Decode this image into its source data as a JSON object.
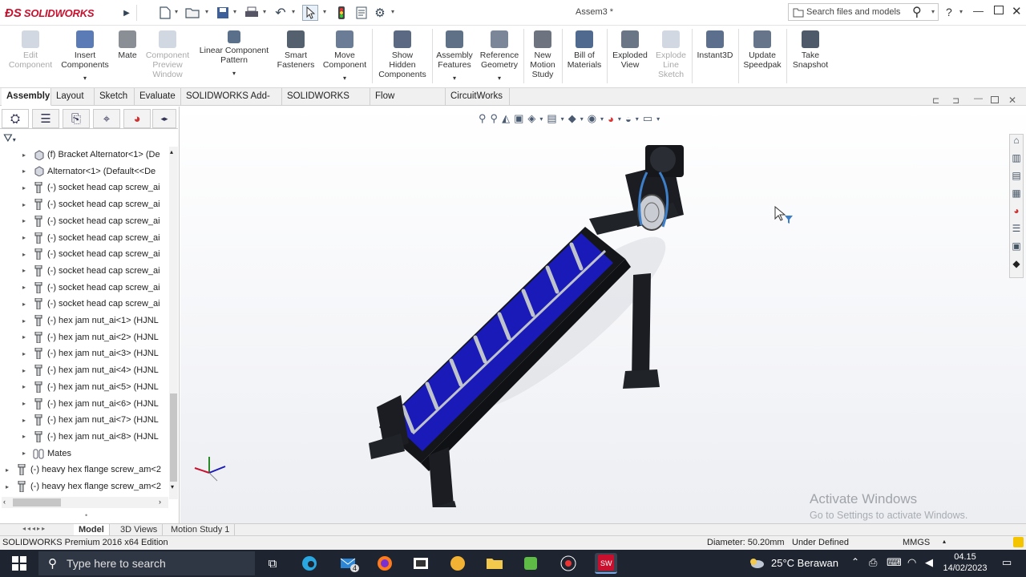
{
  "app": {
    "brand": "SOLIDWORKS",
    "doc_title": "Assem3 *"
  },
  "search": {
    "placeholder": "Search files and models"
  },
  "commands": [
    {
      "label": "Edit Component",
      "lines": [
        "Edit",
        "Component"
      ],
      "enabled": false,
      "icon": "edit-component-icon"
    },
    {
      "label": "Insert Components",
      "lines": [
        "Insert",
        "Components"
      ],
      "enabled": true,
      "icon": "insert-components-icon"
    },
    {
      "label": "Mate",
      "lines": [
        "Mate"
      ],
      "enabled": true,
      "icon": "mate-icon"
    },
    {
      "label": "Component Preview Window",
      "lines": [
        "Component",
        "Preview",
        "Window"
      ],
      "enabled": false,
      "icon": "preview-window-icon"
    },
    {
      "label": "Linear Component Pattern",
      "lines": [
        "Linear Component",
        "Pattern"
      ],
      "enabled": true,
      "icon": "linear-pattern-icon"
    },
    {
      "label": "Smart Fasteners",
      "lines": [
        "Smart",
        "Fasteners"
      ],
      "enabled": true,
      "icon": "smart-fasteners-icon"
    },
    {
      "label": "Move Component",
      "lines": [
        "Move",
        "Component"
      ],
      "enabled": true,
      "icon": "move-component-icon"
    },
    {
      "label": "Show Hidden Components",
      "lines": [
        "Show",
        "Hidden",
        "Components"
      ],
      "enabled": true,
      "icon": "show-hidden-icon"
    },
    {
      "label": "Assembly Features",
      "lines": [
        "Assembly",
        "Features"
      ],
      "enabled": true,
      "icon": "assembly-features-icon"
    },
    {
      "label": "Reference Geometry",
      "lines": [
        "Reference",
        "Geometry"
      ],
      "enabled": true,
      "icon": "reference-geometry-icon"
    },
    {
      "label": "New Motion Study",
      "lines": [
        "New",
        "Motion",
        "Study"
      ],
      "enabled": true,
      "icon": "motion-study-icon"
    },
    {
      "label": "Bill of Materials",
      "lines": [
        "Bill of",
        "Materials"
      ],
      "enabled": true,
      "icon": "bom-icon"
    },
    {
      "label": "Exploded View",
      "lines": [
        "Exploded",
        "View"
      ],
      "enabled": true,
      "icon": "exploded-view-icon"
    },
    {
      "label": "Explode Line Sketch",
      "lines": [
        "Explode",
        "Line",
        "Sketch"
      ],
      "enabled": false,
      "icon": "explode-line-icon"
    },
    {
      "label": "Instant3D",
      "lines": [
        "Instant3D"
      ],
      "enabled": true,
      "icon": "instant3d-icon"
    },
    {
      "label": "Update Speedpak",
      "lines": [
        "Update",
        "Speedpak"
      ],
      "enabled": true,
      "icon": "speedpak-icon"
    },
    {
      "label": "Take Snapshot",
      "lines": [
        "Take",
        "Snapshot"
      ],
      "enabled": true,
      "icon": "snapshot-icon"
    }
  ],
  "tabs": [
    "Assembly",
    "Layout",
    "Sketch",
    "Evaluate",
    "SOLIDWORKS Add-Ins",
    "SOLIDWORKS MBD",
    "Flow Simulation",
    "CircuitWorks"
  ],
  "active_tab": "Assembly",
  "tree": [
    {
      "text": "(f) Bracket Alternator<1> (De",
      "indent": 1,
      "icon": "part-icon"
    },
    {
      "text": "Alternator<1> (Default<<De",
      "indent": 1,
      "icon": "part-icon"
    },
    {
      "text": "(-) socket head cap screw_ai",
      "indent": 1,
      "icon": "screw-icon"
    },
    {
      "text": "(-) socket head cap screw_ai",
      "indent": 1,
      "icon": "screw-icon"
    },
    {
      "text": "(-) socket head cap screw_ai",
      "indent": 1,
      "icon": "screw-icon"
    },
    {
      "text": "(-) socket head cap screw_ai",
      "indent": 1,
      "icon": "screw-icon"
    },
    {
      "text": "(-) socket head cap screw_ai",
      "indent": 1,
      "icon": "screw-icon"
    },
    {
      "text": "(-) socket head cap screw_ai",
      "indent": 1,
      "icon": "screw-icon"
    },
    {
      "text": "(-) socket head cap screw_ai",
      "indent": 1,
      "icon": "screw-icon"
    },
    {
      "text": "(-) socket head cap screw_ai",
      "indent": 1,
      "icon": "screw-icon"
    },
    {
      "text": "(-) hex jam nut_ai<1> (HJNL",
      "indent": 1,
      "icon": "screw-icon"
    },
    {
      "text": "(-) hex jam nut_ai<2> (HJNL",
      "indent": 1,
      "icon": "screw-icon"
    },
    {
      "text": "(-) hex jam nut_ai<3> (HJNL",
      "indent": 1,
      "icon": "screw-icon"
    },
    {
      "text": "(-) hex jam nut_ai<4> (HJNL",
      "indent": 1,
      "icon": "screw-icon"
    },
    {
      "text": "(-) hex jam nut_ai<5> (HJNL",
      "indent": 1,
      "icon": "screw-icon"
    },
    {
      "text": "(-) hex jam nut_ai<6> (HJNL",
      "indent": 1,
      "icon": "screw-icon"
    },
    {
      "text": "(-) hex jam nut_ai<7> (HJNL",
      "indent": 1,
      "icon": "screw-icon"
    },
    {
      "text": "(-) hex jam nut_ai<8> (HJNL",
      "indent": 1,
      "icon": "screw-icon"
    },
    {
      "text": "Mates",
      "indent": 1,
      "icon": "mates-icon"
    },
    {
      "text": "(-) heavy hex flange screw_am<2",
      "indent": 0,
      "icon": "screw-icon"
    },
    {
      "text": "(-) heavy hex flange screw_am<2",
      "indent": 0,
      "icon": "screw-icon"
    }
  ],
  "bottom_tabs": [
    "Model",
    "3D Views",
    "Motion Study 1"
  ],
  "status": {
    "edition": "SOLIDWORKS Premium 2016 x64 Edition",
    "diameter": "Diameter: 50.20mm",
    "defined": "Under Defined",
    "units": "MMGS"
  },
  "watermark": {
    "title": "Activate Windows",
    "subtitle": "Go to Settings to activate Windows."
  },
  "taskbar": {
    "search_placeholder": "Type here to search",
    "weather": "25°C  Berawan",
    "time": "04.15",
    "date": "14/02/2023",
    "mail_badge": "4"
  },
  "colors": {
    "screw_blue": "#1a1ab8",
    "frame": "#1b1d22",
    "accent_red": "#c8102e"
  }
}
